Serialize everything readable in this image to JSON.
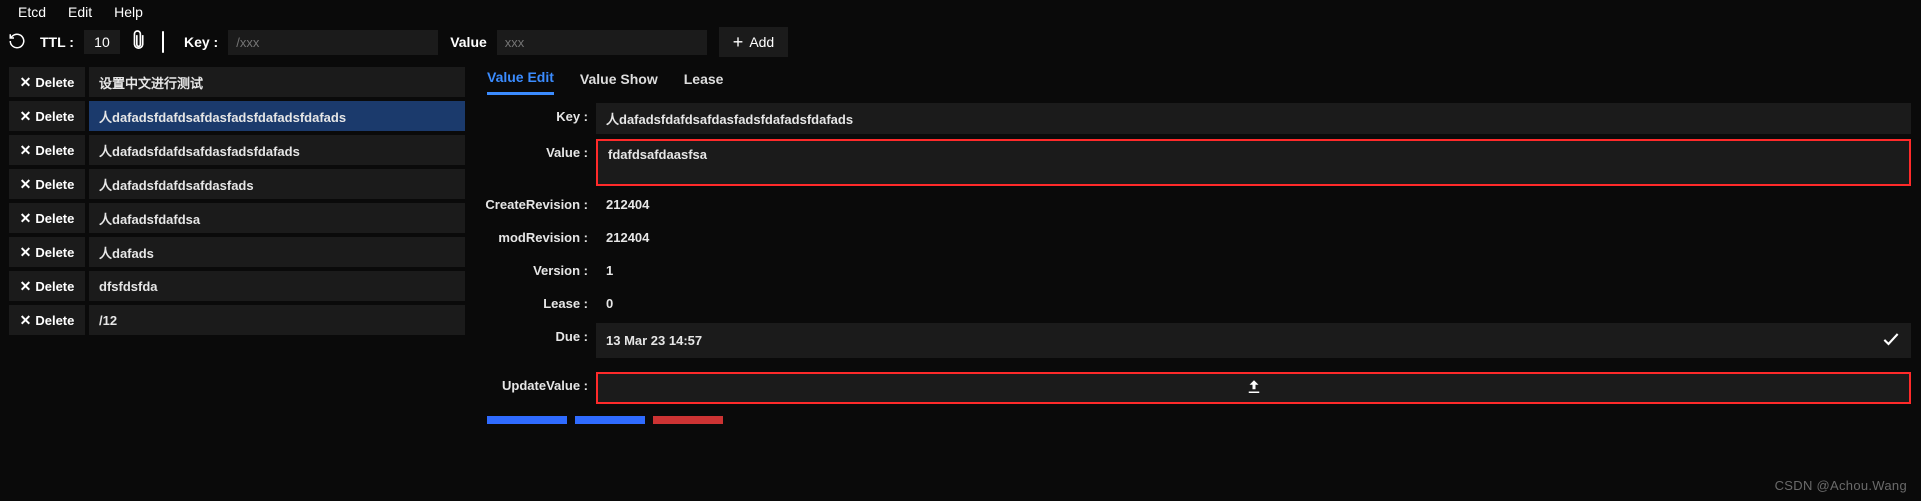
{
  "menu": {
    "etcd": "Etcd",
    "edit": "Edit",
    "help": "Help"
  },
  "toolbar": {
    "ttl_label": "TTL :",
    "ttl_value": "10",
    "key_label": "Key :",
    "key_placeholder": "/xxx",
    "value_label": "Value",
    "value_placeholder": "xxx",
    "add_label": "Add"
  },
  "list": {
    "delete_label": "Delete",
    "items": [
      "设置中文进行测试",
      "人dafadsfdafdsafdasfadsfdafadsfdafads",
      "人dafadsfdafdsafdasfadsfdafads",
      "人dafadsfdafdsafdasfads",
      "人dafadsfdafdsa",
      "人dafads",
      "dfsfdsfda",
      "/12"
    ],
    "selected_index": 1
  },
  "tabs": {
    "value_edit": "Value Edit",
    "value_show": "Value Show",
    "lease": "Lease",
    "active": "value_edit"
  },
  "detail": {
    "key_label": "Key :",
    "key_value": "人dafadsfdafdsafdasfadsfdafadsfdafads",
    "value_label": "Value :",
    "value_value": "fdafdsafdaasfsa",
    "create_rev_label": "CreateRevision :",
    "create_rev_value": "212404",
    "mod_rev_label": "modRevision :",
    "mod_rev_value": "212404",
    "version_label": "Version :",
    "version_value": "1",
    "lease_label": "Lease :",
    "lease_value": "0",
    "due_label": "Due :",
    "due_value": "13 Mar 23 14:57",
    "update_label": "UpdateValue :"
  },
  "watermark": "CSDN @Achou.Wang"
}
